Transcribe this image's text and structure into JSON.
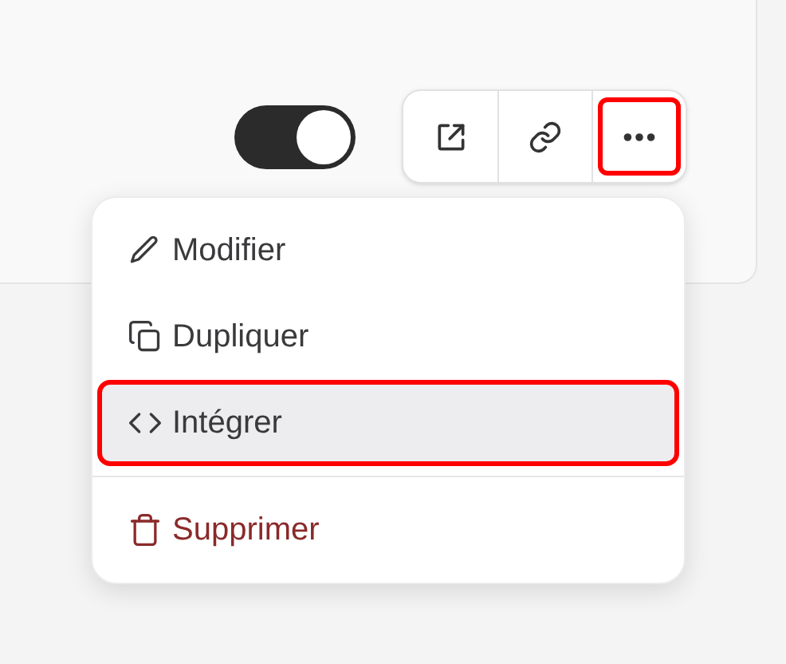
{
  "toggle": {
    "on": true
  },
  "action_buttons": [
    {
      "kind": "open",
      "highlighted": false
    },
    {
      "kind": "link",
      "highlighted": false
    },
    {
      "kind": "more",
      "highlighted": true
    }
  ],
  "menu": {
    "items": [
      {
        "kind": "edit",
        "label": "Modifier",
        "highlighted": false
      },
      {
        "kind": "duplicate",
        "label": "Dupliquer",
        "highlighted": false
      },
      {
        "kind": "embed",
        "label": "Intégrer",
        "highlighted": true
      },
      {
        "kind": "delete",
        "label": "Supprimer",
        "highlighted": false
      }
    ]
  }
}
